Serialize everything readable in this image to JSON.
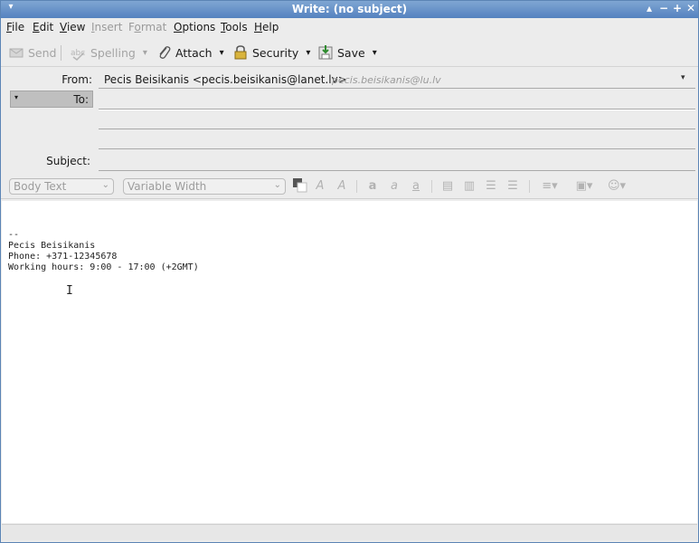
{
  "window": {
    "title": "Write: (no subject)",
    "controls": {
      "menu": "▾",
      "minimize": "−",
      "maximize": "+",
      "close": "✕"
    }
  },
  "menubar": [
    {
      "label": "File",
      "underline": "F",
      "enabled": true
    },
    {
      "label": "Edit",
      "underline": "E",
      "enabled": true
    },
    {
      "label": "View",
      "underline": "V",
      "enabled": true
    },
    {
      "label": "Insert",
      "underline": "I",
      "enabled": false
    },
    {
      "label": "Format",
      "underline": "o",
      "enabled": false
    },
    {
      "label": "Options",
      "underline": "O",
      "enabled": true
    },
    {
      "label": "Tools",
      "underline": "T",
      "enabled": true
    },
    {
      "label": "Help",
      "underline": "H",
      "enabled": true
    }
  ],
  "toolbar": {
    "send": "Send",
    "spelling": "Spelling",
    "attach": "Attach",
    "security": "Security",
    "save": "Save"
  },
  "headers": {
    "from_label": "From:",
    "from_value": "Pecis Beisikanis <pecis.beisikanis@lanet.lv>",
    "from_alt": "pecis.beisikanis@lu.lv",
    "to_label": "To:",
    "subject_label": "Subject:"
  },
  "format": {
    "paragraph_style": "Body Text",
    "font": "Variable Width"
  },
  "body": {
    "signature": "--\nPecis Beisikanis\nPhone: +371-12345678\nWorking hours: 9:00 - 17:00 (+2GMT)",
    "cursor": "I"
  },
  "colors": {
    "titlebar": "#5b84b5",
    "chrome": "#ececec",
    "body_bg": "#ffffff",
    "disabled_text": "#9a9a9a"
  }
}
